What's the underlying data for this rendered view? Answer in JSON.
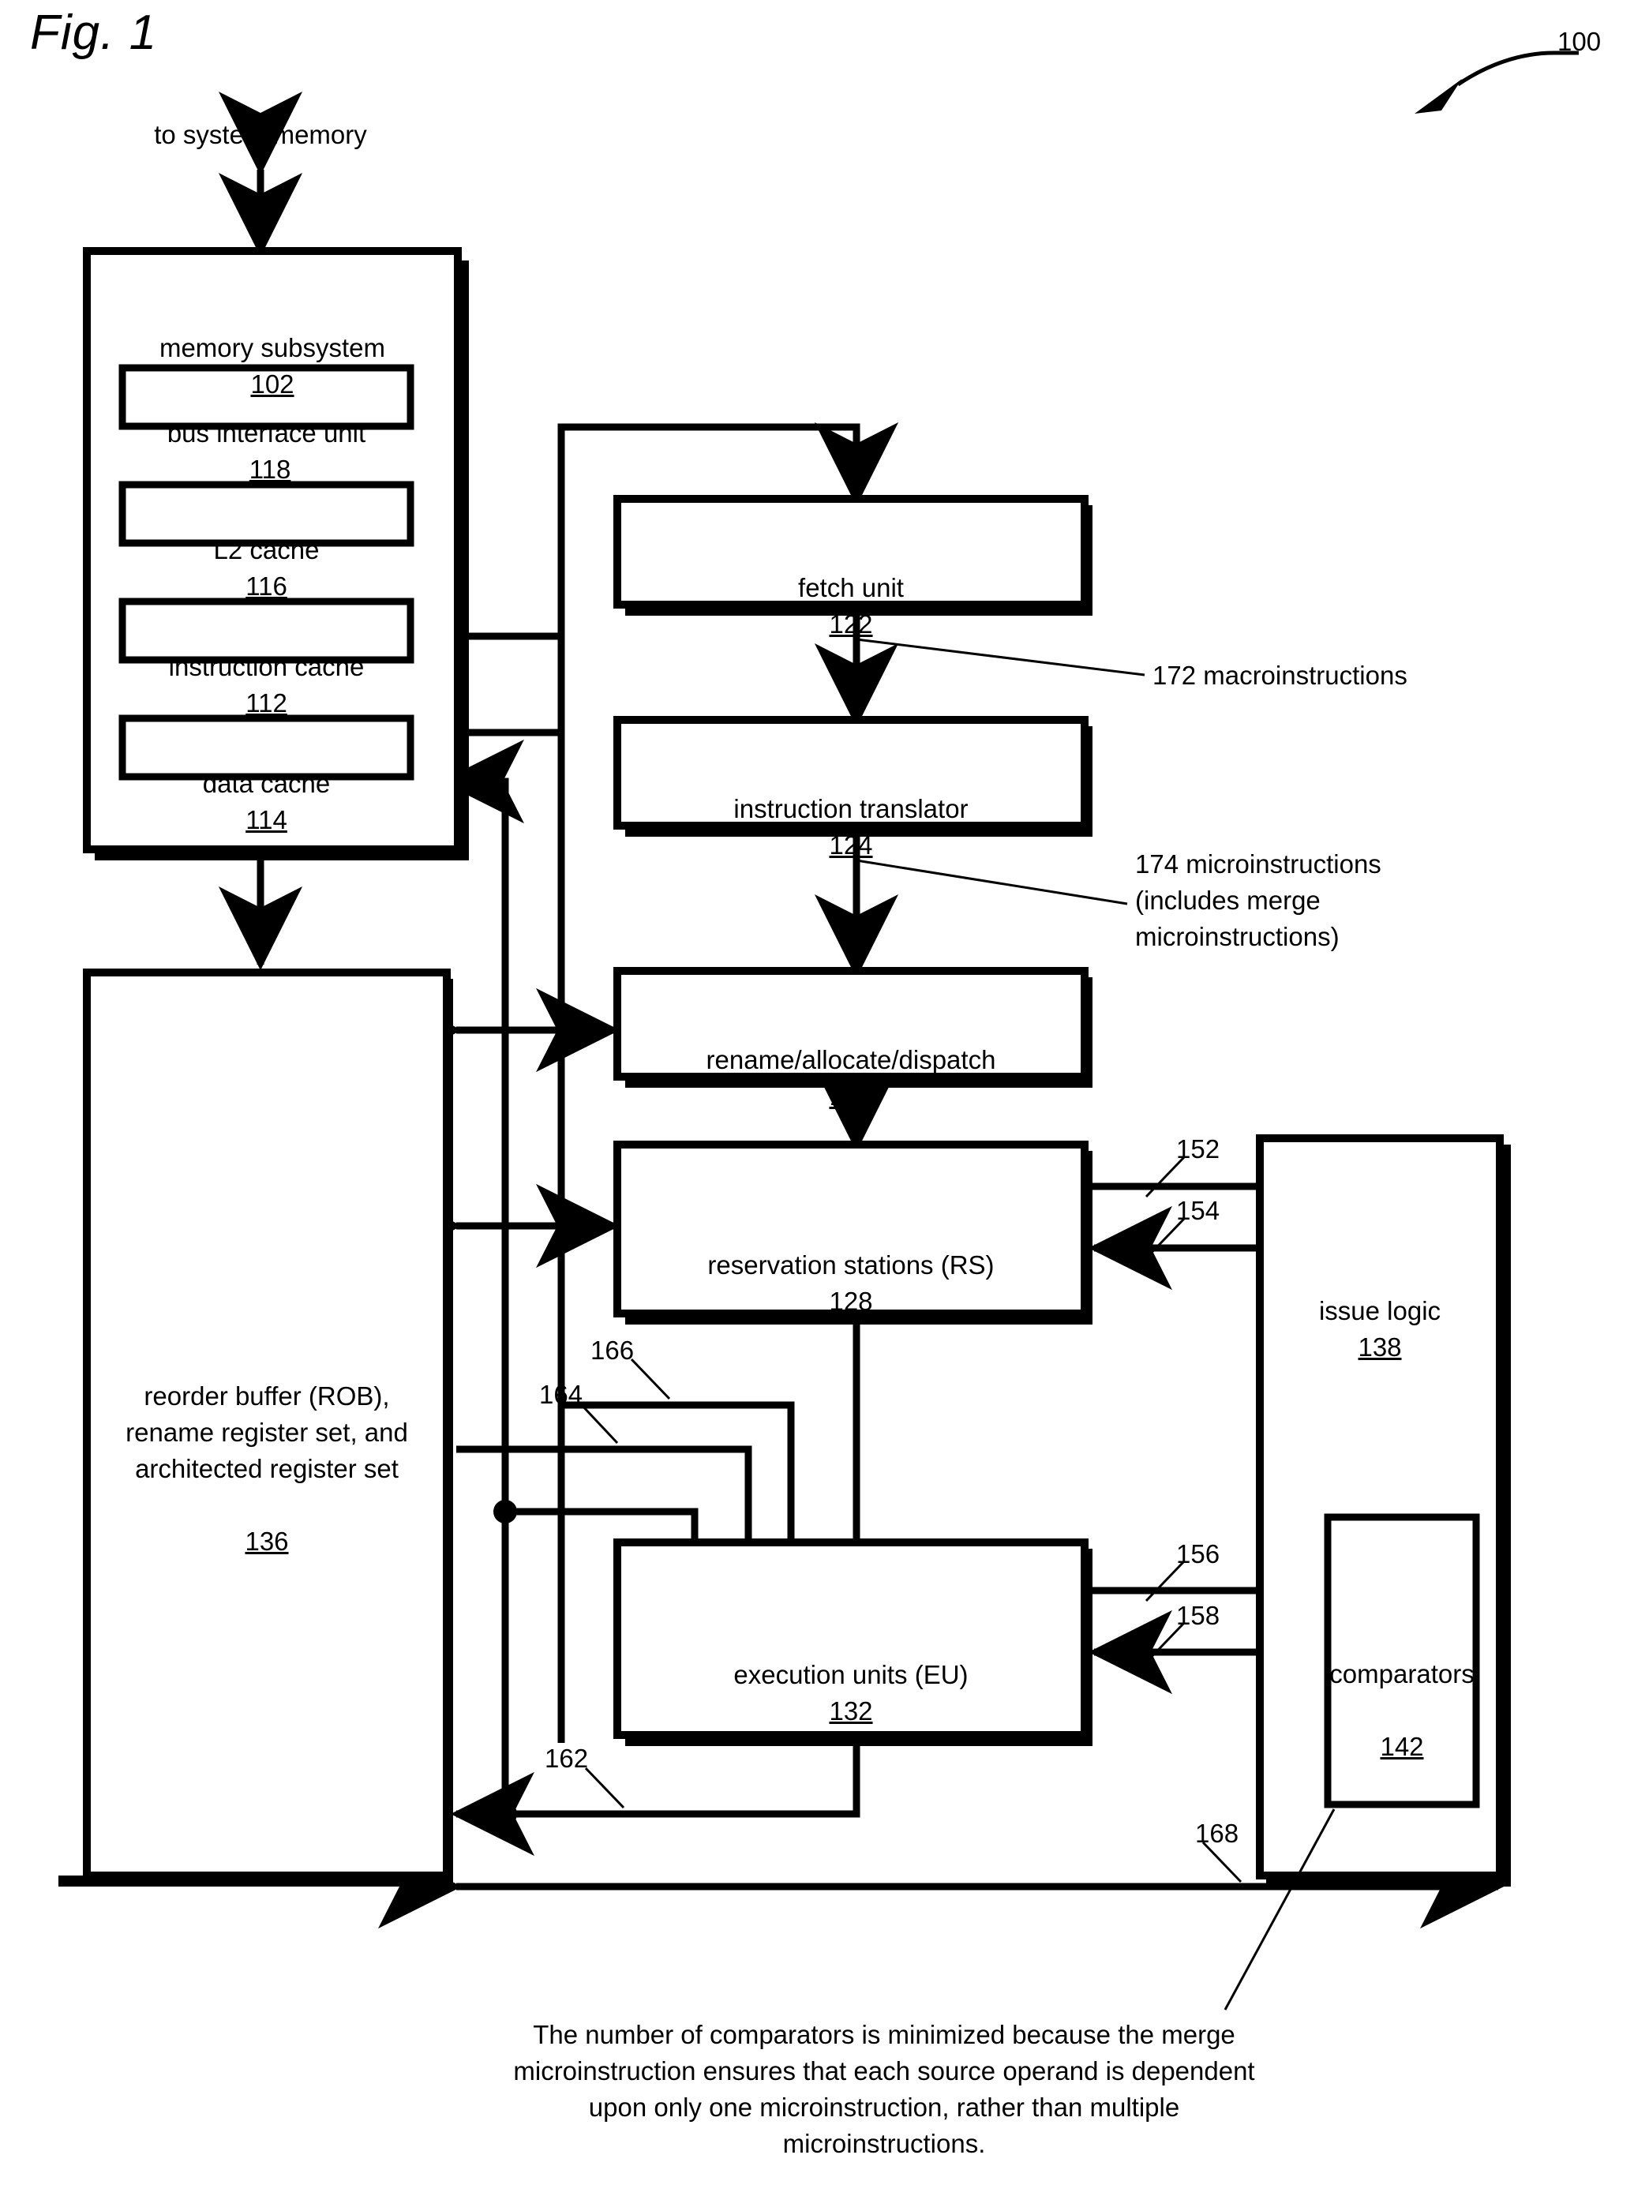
{
  "figure": {
    "title": "Fig. 1",
    "system_ref": "100",
    "top_label": "to system memory"
  },
  "blocks": {
    "memory_subsystem": {
      "label": "memory subsystem",
      "ref": "102"
    },
    "bus_interface_unit": {
      "label": "bus interface unit",
      "ref": "118"
    },
    "l2_cache": {
      "label": "L2 cache",
      "ref": "116"
    },
    "instruction_cache": {
      "label": "instruction cache",
      "ref": "112"
    },
    "data_cache": {
      "label": "data cache",
      "ref": "114"
    },
    "fetch_unit": {
      "label": "fetch unit",
      "ref": "122"
    },
    "instruction_translator": {
      "label": "instruction translator",
      "ref": "124"
    },
    "rename_allocate_dispatch": {
      "label": "rename/allocate/dispatch",
      "ref": "126"
    },
    "reservation_stations": {
      "label": "reservation stations (RS)",
      "ref": "128"
    },
    "execution_units": {
      "label": "execution units (EU)",
      "ref": "132"
    },
    "reorder_buffer": {
      "label": "reorder buffer (ROB),\nrename register set, and\narchitected register set",
      "ref": "136"
    },
    "issue_logic": {
      "label": "issue logic",
      "ref": "138"
    },
    "comparators": {
      "label": "comparators",
      "ref": "142"
    }
  },
  "signals": {
    "macroinstructions": {
      "ref": "172",
      "text": "172 macroinstructions"
    },
    "microinstructions": {
      "ref": "174",
      "text": "174 microinstructions\n(includes merge\nmicroinstructions)"
    },
    "s152": "152",
    "s154": "154",
    "s156": "156",
    "s158": "158",
    "s162": "162",
    "s164": "164",
    "s166": "166",
    "s168": "168"
  },
  "caption": {
    "text": "The number of comparators is minimized because the merge microinstruction ensures that each source operand is dependent upon only one microinstruction, rather than multiple microinstructions."
  },
  "colors": {
    "ink": "#000000",
    "paper": "#ffffff"
  }
}
